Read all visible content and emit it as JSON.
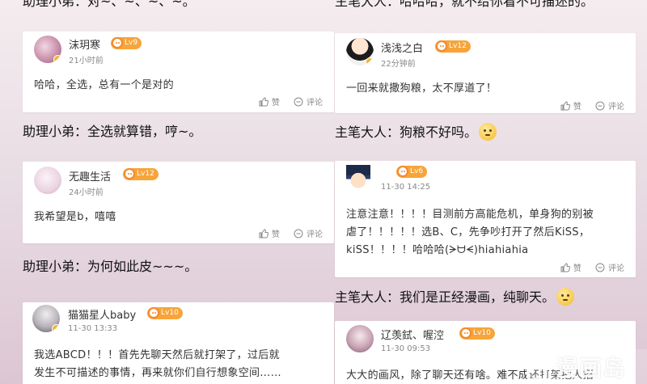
{
  "left": {
    "top_heading": "助理小弟：对~、~、~、~。",
    "cards": [
      {
        "name": "沫玥寒",
        "level": "Lv9",
        "time": "21小时前",
        "text": "哈哈，全选，总有一个是对的",
        "like": "赞",
        "comment": "评论"
      },
      {
        "name": "无趣生活",
        "level": "Lv12",
        "time": "24小时前",
        "text": "我希望是b，嘻嘻",
        "like": "赞",
        "comment": "评论"
      },
      {
        "name": "猫猫星人baby",
        "level": "Lv10",
        "time": "11-30 13:33",
        "text_lines": [
          "我选ABCD！！！首先先聊天然后就打架了，过后就",
          "发生不可描述的事情，再来就你们自行想象空间……"
        ],
        "like": "赞",
        "comment": "评论"
      }
    ],
    "headings": [
      "助理小弟：全选就算错，哼~。",
      "助理小弟：为何如此皮~~~。"
    ]
  },
  "right": {
    "top_heading": "主笔大人：哈哈哈，就不给你看不可描述的。",
    "cards": [
      {
        "name": "浅浅之白",
        "level": "Lv12",
        "time": "22分钟前",
        "text": "一回来就撒狗粮，太不厚道了！",
        "like": "赞",
        "comment": "评论"
      },
      {
        "name": "",
        "level": "Lv6",
        "time": "11-30 14:25",
        "text_lines": [
          "注意注意！！！！目测前方高能危机，单身狗的别被",
          "虐了！！！！！选B、C，先争吵打开了然后KiSS，",
          "kiSS！！！！哈哈哈(ᗒᗨᗕ)hiahiahia"
        ],
        "like": "赞",
        "comment": "评论"
      },
      {
        "name": "辽羡鉽、喔涳",
        "level": "Lv10",
        "time": "11-30 09:53",
        "text": "大大的画风，除了聊天还有啥。难不成还打架把人招",
        "like": "",
        "comment": ""
      }
    ],
    "headings": [
      "主笔大人：狗粮不好吗。",
      "主笔大人：我们是正经漫画，纯聊天。"
    ]
  },
  "watermark": {
    "m": "M",
    "text": "漫画岛"
  },
  "colors": {
    "level_badge": "#f7a43a",
    "card_bg": "#ffffff",
    "meta_text": "#888888"
  }
}
